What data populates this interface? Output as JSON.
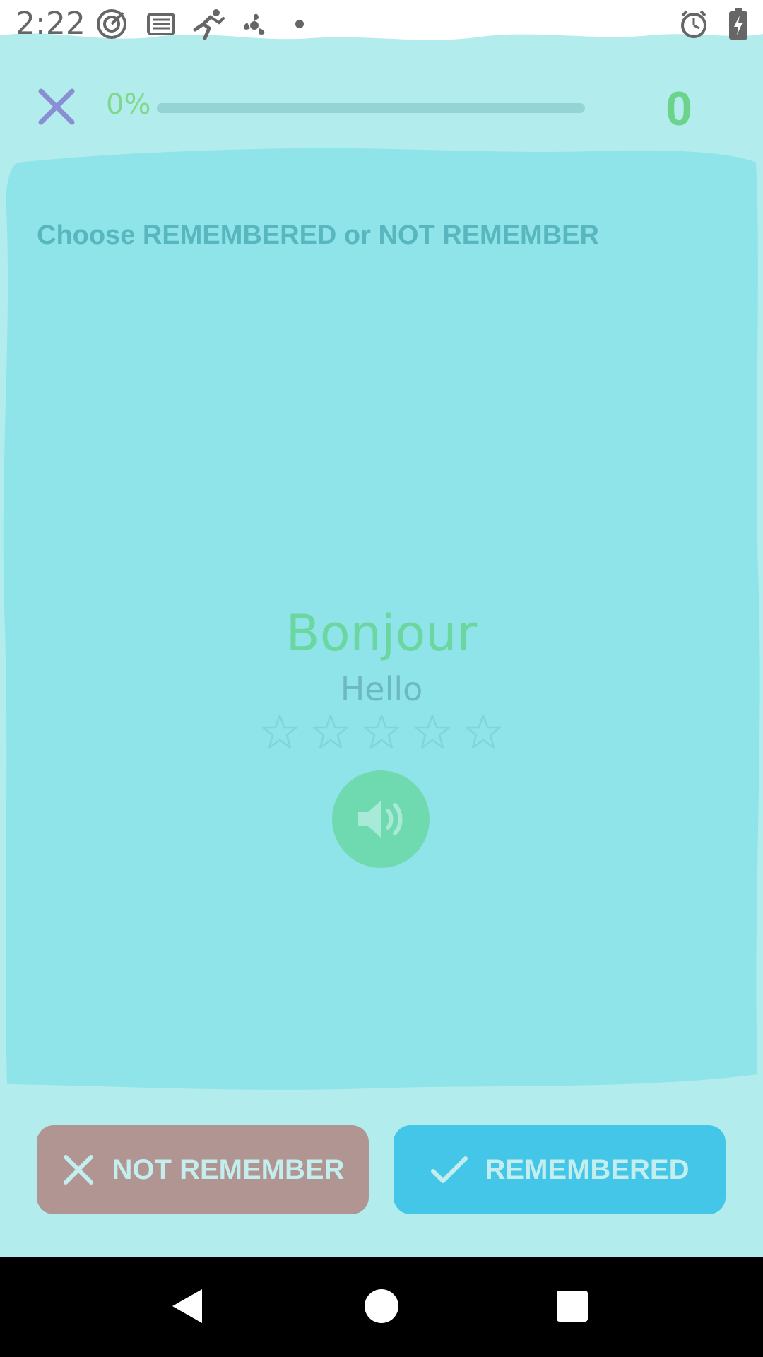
{
  "status_bar": {
    "time": "2:22",
    "icons": [
      "target-icon",
      "list-icon",
      "runner-icon",
      "fan-icon",
      "dot-icon",
      "alarm-icon",
      "battery-icon"
    ]
  },
  "header": {
    "progress_label": "0%",
    "progress_fraction": 0,
    "score": "0"
  },
  "card": {
    "instruction": "Choose REMEMBERED or NOT REMEMBER",
    "word": "Bonjour",
    "translation": "Hello",
    "stars_total": 5,
    "stars_filled": 0
  },
  "actions": {
    "not_remember_label": "NOT REMEMBER",
    "remembered_label": "REMEMBERED"
  },
  "colors": {
    "background": "#b3ecec",
    "card": "#8ee4e8",
    "accent_green": "#6cd38a",
    "not_remember": "#b09592",
    "remembered": "#43c6e8"
  }
}
